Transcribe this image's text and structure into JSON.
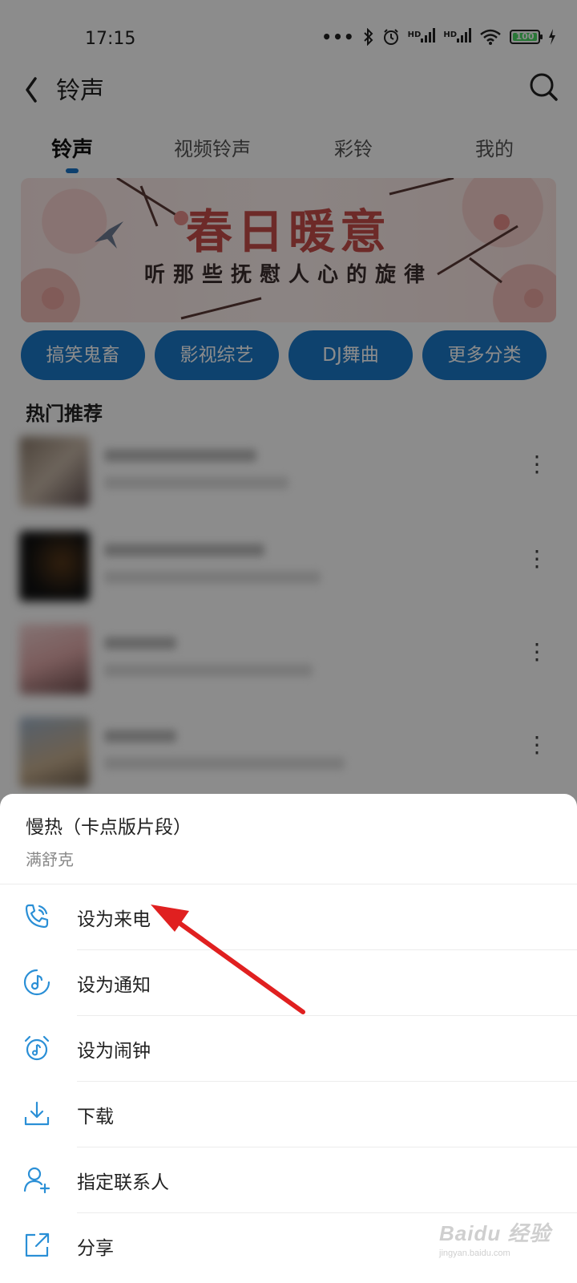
{
  "status_bar": {
    "time": "17:15",
    "dots": "•••",
    "battery": "100",
    "hd": "HD"
  },
  "header": {
    "title": "铃声",
    "back_icon": "chevron-left-icon",
    "search_icon": "search-icon"
  },
  "tabs": [
    {
      "label": "铃声",
      "active": true
    },
    {
      "label": "视频铃声",
      "active": false
    },
    {
      "label": "彩铃",
      "active": false
    },
    {
      "label": "我的",
      "active": false
    }
  ],
  "banner": {
    "title": "春日暖意",
    "subtitle": "听那些抚慰人心的旋律"
  },
  "categories": [
    "搞笑鬼畜",
    "影视综艺",
    "DJ舞曲",
    "更多分类"
  ],
  "section": {
    "title": "热门推荐"
  },
  "sheet": {
    "song_title": "慢热（卡点版片段）",
    "artist": "满舒克",
    "actions": [
      {
        "label": "设为来电",
        "icon": "phone-icon"
      },
      {
        "label": "设为通知",
        "icon": "music-note-icon"
      },
      {
        "label": "设为闹钟",
        "icon": "alarm-clock-icon"
      },
      {
        "label": "下载",
        "icon": "download-icon"
      },
      {
        "label": "指定联系人",
        "icon": "add-contact-icon"
      },
      {
        "label": "分享",
        "icon": "share-icon"
      }
    ]
  },
  "watermark": {
    "main": "Baidu 经验",
    "sub": "jingyan.baidu.com"
  },
  "colors": {
    "accent": "#1b78c8",
    "icon_blue": "#2a8fd6",
    "annotation_red": "#e02020"
  }
}
